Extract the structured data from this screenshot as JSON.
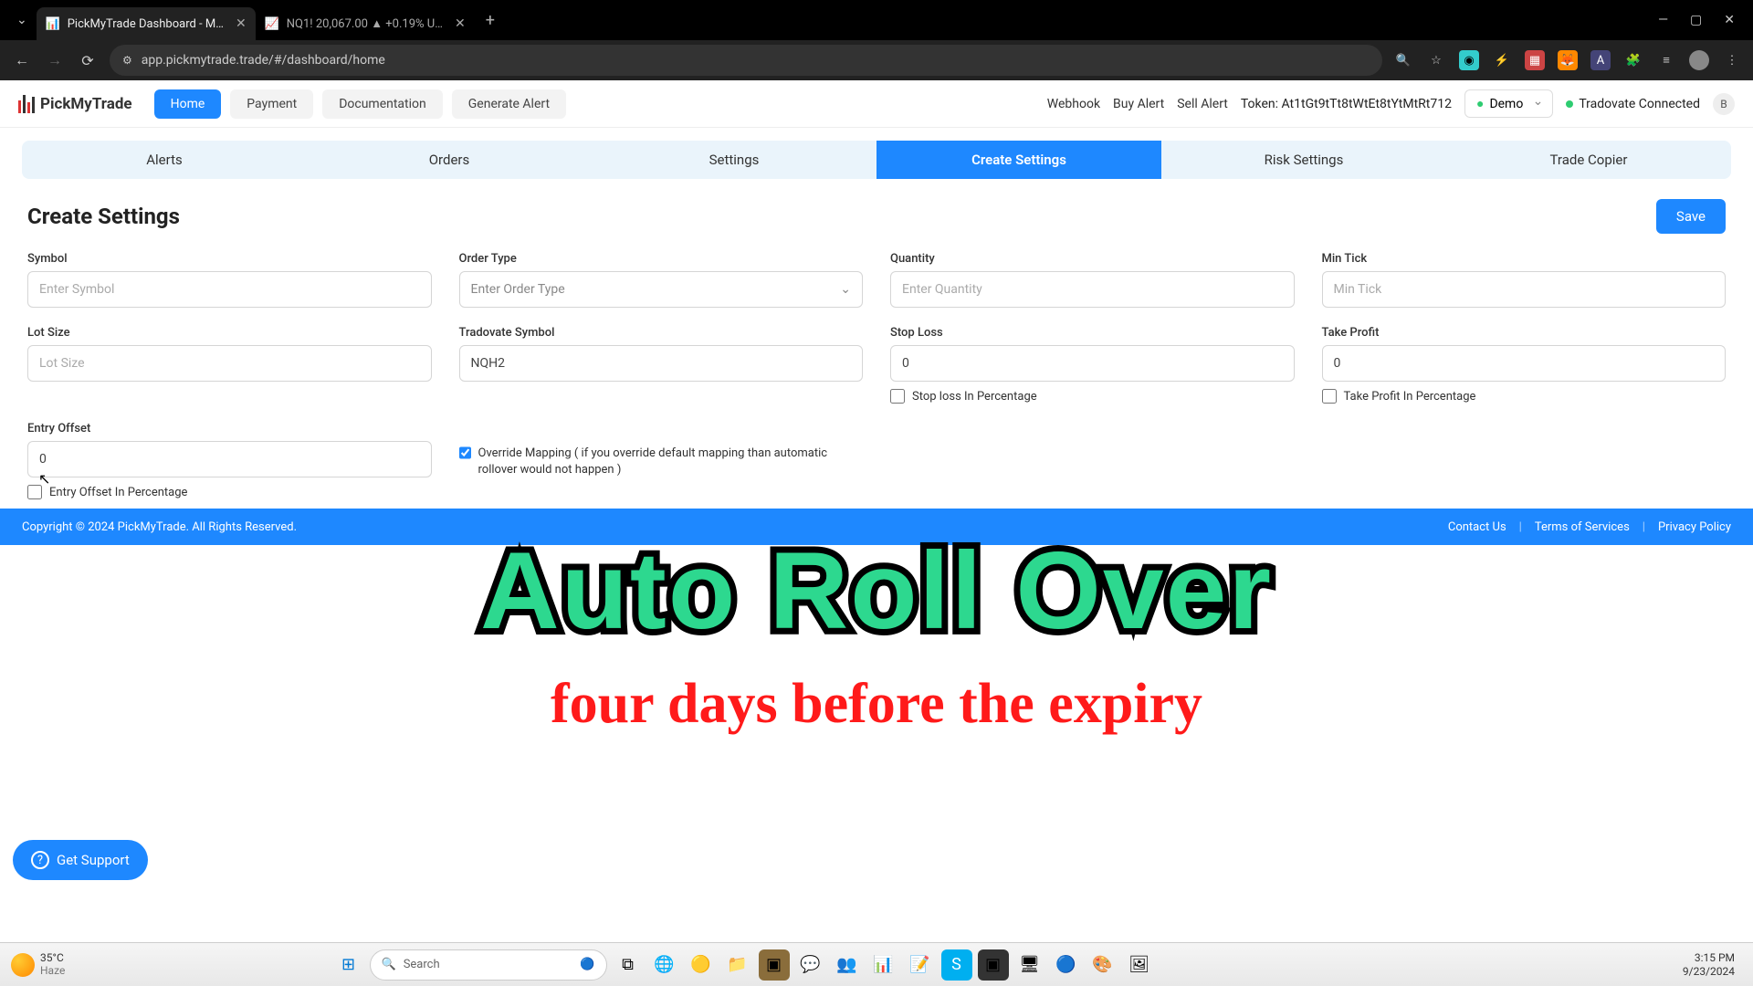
{
  "browser": {
    "tabs": [
      {
        "title": "PickMyTrade Dashboard - Man"
      },
      {
        "title": "NQ1! 20,067.00 ▲ +0.19% Unn"
      }
    ],
    "url": "app.pickmytrade.trade/#/dashboard/home"
  },
  "app_header": {
    "brand": "PickMyTrade",
    "nav": {
      "home": "Home",
      "payment": "Payment",
      "documentation": "Documentation",
      "generate_alert": "Generate Alert"
    },
    "webhook": "Webhook",
    "buy_alert": "Buy Alert",
    "sell_alert": "Sell Alert",
    "token_label": "Token:",
    "token_value": "At1tGt9tTt8tWtEt8tYtMtRt712",
    "demo": "Demo",
    "connected": "Tradovate Connected",
    "avatar": "B"
  },
  "subtabs": {
    "alerts": "Alerts",
    "orders": "Orders",
    "settings": "Settings",
    "create_settings": "Create Settings",
    "risk_settings": "Risk Settings",
    "trade_copier": "Trade Copier"
  },
  "page": {
    "title": "Create Settings",
    "save": "Save"
  },
  "form": {
    "symbol": {
      "label": "Symbol",
      "placeholder": "Enter Symbol"
    },
    "order_type": {
      "label": "Order Type",
      "placeholder": "Enter Order Type"
    },
    "quantity": {
      "label": "Quantity",
      "placeholder": "Enter Quantity"
    },
    "min_tick": {
      "label": "Min Tick",
      "placeholder": "Min Tick"
    },
    "lot_size": {
      "label": "Lot Size",
      "placeholder": "Lot Size"
    },
    "tradovate_symbol": {
      "label": "Tradovate Symbol",
      "value": "NQH2"
    },
    "stop_loss": {
      "label": "Stop Loss",
      "value": "0",
      "cb": "Stop loss In Percentage"
    },
    "take_profit": {
      "label": "Take Profit",
      "value": "0",
      "cb": "Take Profit In Percentage"
    },
    "entry_offset": {
      "label": "Entry Offset",
      "value": "0",
      "cb": "Entry Offset In Percentage"
    },
    "override": "Override Mapping ( if you override default mapping than automatic rollover would not happen )"
  },
  "overlay": {
    "line1": "Auto Roll Over",
    "line2": "four days before the expiry"
  },
  "support": "Get Support",
  "footer": {
    "copyright": "Copyright © 2024 PickMyTrade. All Rights Reserved.",
    "contact": "Contact Us",
    "terms": "Terms of Services",
    "privacy": "Privacy Policy"
  },
  "taskbar": {
    "temp": "35°C",
    "cond": "Haze",
    "search": "Search",
    "time": "3:15 PM",
    "date": "9/23/2024"
  }
}
